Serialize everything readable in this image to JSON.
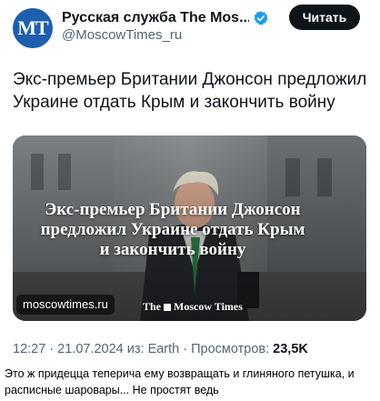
{
  "account": {
    "avatar_text": "MT",
    "display_name": "Русская служба The Mos...",
    "handle": "@MoscowTimes_ru",
    "follow_label": "Читать",
    "verified_icon": "verified-badge-icon",
    "brand_color": "#1d5fae"
  },
  "tweet": {
    "text": "Экс-премьер Британии Джонсон предложил Украине отдать Крым и закончить войну",
    "media": {
      "headline": "Экс-премьер Британии Джонсон предложил Украине отдать Крым и закончить войну",
      "source": "moscowtimes.ru",
      "brand_prefix": "The",
      "brand_name": "Moscow Times"
    },
    "meta": {
      "time_date": "12:27 · 21.07.2024 из: Earth · Просмотров:",
      "views": "23,5K"
    }
  },
  "comment": {
    "text": "Это ж придецца теперича ему возвращать и глиняного петушка, и расписные шаровары... Не простят ведь"
  }
}
